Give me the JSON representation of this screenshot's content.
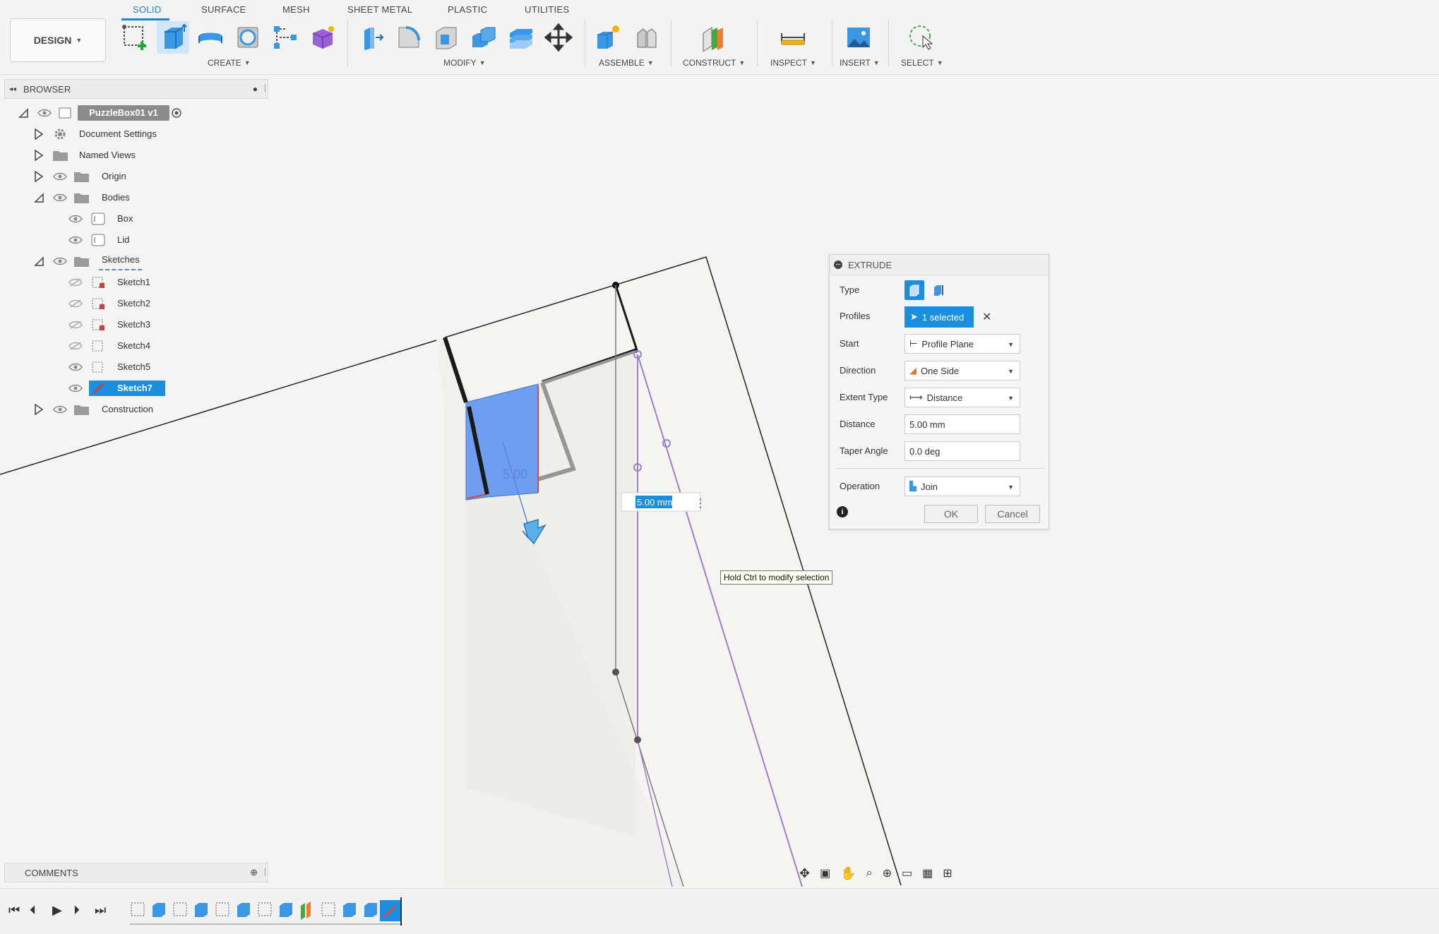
{
  "toolbar": {
    "design_label": "DESIGN",
    "tabs": [
      "SOLID",
      "SURFACE",
      "MESH",
      "SHEET METAL",
      "PLASTIC",
      "UTILITIES"
    ],
    "groups": [
      "CREATE",
      "MODIFY",
      "ASSEMBLE",
      "CONSTRUCT",
      "INSPECT",
      "INSERT",
      "SELECT"
    ]
  },
  "browser": {
    "title": "BROWSER",
    "root": "PuzzleBox01 v1",
    "items": {
      "document_settings": "Document Settings",
      "named_views": "Named Views",
      "origin": "Origin",
      "bodies": "Bodies",
      "box": "Box",
      "lid": "Lid",
      "sketches": "Sketches",
      "sketch1": "Sketch1",
      "sketch2": "Sketch2",
      "sketch3": "Sketch3",
      "sketch4": "Sketch4",
      "sketch5": "Sketch5",
      "sketch7": "Sketch7",
      "construction": "Construction"
    }
  },
  "extrude": {
    "title": "EXTRUDE",
    "type_label": "Type",
    "profiles_label": "Profiles",
    "profiles_value": "1 selected",
    "start_label": "Start",
    "start_value": "Profile Plane",
    "direction_label": "Direction",
    "direction_value": "One Side",
    "extent_label": "Extent Type",
    "extent_value": "Distance",
    "distance_label": "Distance",
    "distance_value": "5.00 mm",
    "taper_label": "Taper Angle",
    "taper_value": "0.0 deg",
    "operation_label": "Operation",
    "operation_value": "Join",
    "ok": "OK",
    "cancel": "Cancel"
  },
  "viewport": {
    "dimension_text": "5.00",
    "inline_distance": "5.00 mm",
    "tooltip": "Hold Ctrl to modify selection"
  },
  "comments": {
    "title": "COMMENTS"
  },
  "colors": {
    "accent": "#1b8ee0",
    "profile_fill": "#6f9ef0",
    "sketch_line": "#9b7fd1"
  }
}
